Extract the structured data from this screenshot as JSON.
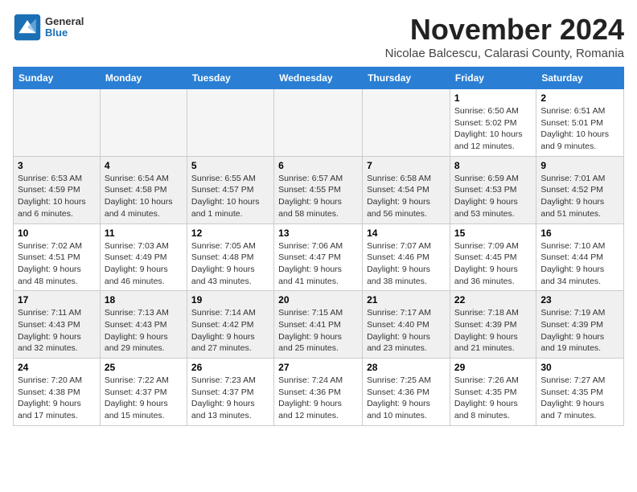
{
  "header": {
    "logo": {
      "general": "General",
      "blue": "Blue"
    },
    "title": "November 2024",
    "subtitle": "Nicolae Balcescu, Calarasi County, Romania"
  },
  "weekdays": [
    "Sunday",
    "Monday",
    "Tuesday",
    "Wednesday",
    "Thursday",
    "Friday",
    "Saturday"
  ],
  "weeks": [
    [
      {
        "day": "",
        "info": ""
      },
      {
        "day": "",
        "info": ""
      },
      {
        "day": "",
        "info": ""
      },
      {
        "day": "",
        "info": ""
      },
      {
        "day": "",
        "info": ""
      },
      {
        "day": "1",
        "info": "Sunrise: 6:50 AM\nSunset: 5:02 PM\nDaylight: 10 hours and 12 minutes."
      },
      {
        "day": "2",
        "info": "Sunrise: 6:51 AM\nSunset: 5:01 PM\nDaylight: 10 hours and 9 minutes."
      }
    ],
    [
      {
        "day": "3",
        "info": "Sunrise: 6:53 AM\nSunset: 4:59 PM\nDaylight: 10 hours and 6 minutes."
      },
      {
        "day": "4",
        "info": "Sunrise: 6:54 AM\nSunset: 4:58 PM\nDaylight: 10 hours and 4 minutes."
      },
      {
        "day": "5",
        "info": "Sunrise: 6:55 AM\nSunset: 4:57 PM\nDaylight: 10 hours and 1 minute."
      },
      {
        "day": "6",
        "info": "Sunrise: 6:57 AM\nSunset: 4:55 PM\nDaylight: 9 hours and 58 minutes."
      },
      {
        "day": "7",
        "info": "Sunrise: 6:58 AM\nSunset: 4:54 PM\nDaylight: 9 hours and 56 minutes."
      },
      {
        "day": "8",
        "info": "Sunrise: 6:59 AM\nSunset: 4:53 PM\nDaylight: 9 hours and 53 minutes."
      },
      {
        "day": "9",
        "info": "Sunrise: 7:01 AM\nSunset: 4:52 PM\nDaylight: 9 hours and 51 minutes."
      }
    ],
    [
      {
        "day": "10",
        "info": "Sunrise: 7:02 AM\nSunset: 4:51 PM\nDaylight: 9 hours and 48 minutes."
      },
      {
        "day": "11",
        "info": "Sunrise: 7:03 AM\nSunset: 4:49 PM\nDaylight: 9 hours and 46 minutes."
      },
      {
        "day": "12",
        "info": "Sunrise: 7:05 AM\nSunset: 4:48 PM\nDaylight: 9 hours and 43 minutes."
      },
      {
        "day": "13",
        "info": "Sunrise: 7:06 AM\nSunset: 4:47 PM\nDaylight: 9 hours and 41 minutes."
      },
      {
        "day": "14",
        "info": "Sunrise: 7:07 AM\nSunset: 4:46 PM\nDaylight: 9 hours and 38 minutes."
      },
      {
        "day": "15",
        "info": "Sunrise: 7:09 AM\nSunset: 4:45 PM\nDaylight: 9 hours and 36 minutes."
      },
      {
        "day": "16",
        "info": "Sunrise: 7:10 AM\nSunset: 4:44 PM\nDaylight: 9 hours and 34 minutes."
      }
    ],
    [
      {
        "day": "17",
        "info": "Sunrise: 7:11 AM\nSunset: 4:43 PM\nDaylight: 9 hours and 32 minutes."
      },
      {
        "day": "18",
        "info": "Sunrise: 7:13 AM\nSunset: 4:43 PM\nDaylight: 9 hours and 29 minutes."
      },
      {
        "day": "19",
        "info": "Sunrise: 7:14 AM\nSunset: 4:42 PM\nDaylight: 9 hours and 27 minutes."
      },
      {
        "day": "20",
        "info": "Sunrise: 7:15 AM\nSunset: 4:41 PM\nDaylight: 9 hours and 25 minutes."
      },
      {
        "day": "21",
        "info": "Sunrise: 7:17 AM\nSunset: 4:40 PM\nDaylight: 9 hours and 23 minutes."
      },
      {
        "day": "22",
        "info": "Sunrise: 7:18 AM\nSunset: 4:39 PM\nDaylight: 9 hours and 21 minutes."
      },
      {
        "day": "23",
        "info": "Sunrise: 7:19 AM\nSunset: 4:39 PM\nDaylight: 9 hours and 19 minutes."
      }
    ],
    [
      {
        "day": "24",
        "info": "Sunrise: 7:20 AM\nSunset: 4:38 PM\nDaylight: 9 hours and 17 minutes."
      },
      {
        "day": "25",
        "info": "Sunrise: 7:22 AM\nSunset: 4:37 PM\nDaylight: 9 hours and 15 minutes."
      },
      {
        "day": "26",
        "info": "Sunrise: 7:23 AM\nSunset: 4:37 PM\nDaylight: 9 hours and 13 minutes."
      },
      {
        "day": "27",
        "info": "Sunrise: 7:24 AM\nSunset: 4:36 PM\nDaylight: 9 hours and 12 minutes."
      },
      {
        "day": "28",
        "info": "Sunrise: 7:25 AM\nSunset: 4:36 PM\nDaylight: 9 hours and 10 minutes."
      },
      {
        "day": "29",
        "info": "Sunrise: 7:26 AM\nSunset: 4:35 PM\nDaylight: 9 hours and 8 minutes."
      },
      {
        "day": "30",
        "info": "Sunrise: 7:27 AM\nSunset: 4:35 PM\nDaylight: 9 hours and 7 minutes."
      }
    ]
  ]
}
